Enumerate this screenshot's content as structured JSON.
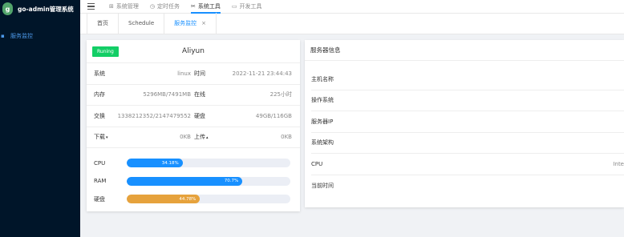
{
  "app": {
    "title": "go-admin管理系统",
    "logo_letter": "g"
  },
  "sidebar": {
    "items": [
      {
        "label": "服务监控",
        "icon": "monitor-icon"
      }
    ]
  },
  "topnav": {
    "items": [
      {
        "label": "系统管理",
        "icon": "grid-icon",
        "active": false
      },
      {
        "label": "定时任务",
        "icon": "timer-icon",
        "active": false
      },
      {
        "label": "系统工具",
        "icon": "tools-icon",
        "active": true
      },
      {
        "label": "开发工具",
        "icon": "code-icon",
        "active": false
      }
    ]
  },
  "tabs": [
    {
      "label": "首页",
      "active": false
    },
    {
      "label": "Schedule",
      "active": false
    },
    {
      "label": "服务监控",
      "active": true,
      "close": "×"
    }
  ],
  "status_card": {
    "badge": "Runing",
    "hostname": "Aliyun",
    "rows": [
      {
        "k1": "系统",
        "v1": "linux",
        "k2": "时间",
        "v2": "2022-11-21 23:44:43"
      },
      {
        "k1": "内存",
        "v1": "5296MB/7491MB",
        "k2": "在线",
        "v2": "225小时"
      },
      {
        "k1": "交换",
        "v1": "1338212352/2147479552",
        "k2": "硬盘",
        "v2": "49GB/116GB"
      },
      {
        "k1": "下载",
        "k1_arrow": "▾",
        "v1": "0KB",
        "k2": "上传",
        "k2_arrow": "▴",
        "v2": "0KB"
      }
    ],
    "bars": [
      {
        "label": "CPU",
        "percent": 34.18,
        "text": "34.18%",
        "color": "#1890ff"
      },
      {
        "label": "RAM",
        "percent": 70.7,
        "text": "70.7%",
        "color": "#1890ff"
      },
      {
        "label": "硬盘",
        "percent": 44.78,
        "text": "44.78%",
        "color": "#e6a23c"
      }
    ]
  },
  "server_info": {
    "title": "服务器信息",
    "rows": [
      {
        "label": "主机名称",
        "value": ""
      },
      {
        "label": "操作系统",
        "value": ""
      },
      {
        "label": "服务器IP",
        "value": ""
      },
      {
        "label": "系统架构",
        "value": ""
      },
      {
        "label": "CPU",
        "value": "Inte"
      },
      {
        "label": "当前时间",
        "value": ""
      }
    ]
  }
}
